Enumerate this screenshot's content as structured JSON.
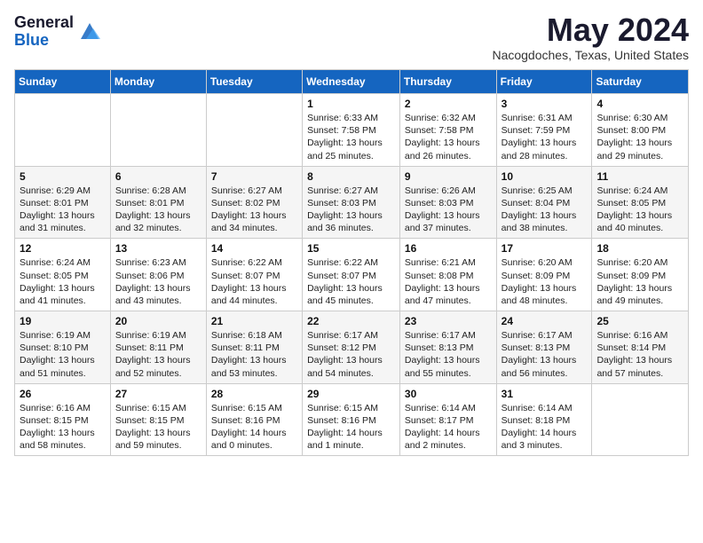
{
  "header": {
    "logo_general": "General",
    "logo_blue": "Blue",
    "month_year": "May 2024",
    "location": "Nacogdoches, Texas, United States"
  },
  "days_of_week": [
    "Sunday",
    "Monday",
    "Tuesday",
    "Wednesday",
    "Thursday",
    "Friday",
    "Saturday"
  ],
  "weeks": [
    [
      {
        "day": "",
        "sunrise": "",
        "sunset": "",
        "daylight": "",
        "empty": true
      },
      {
        "day": "",
        "sunrise": "",
        "sunset": "",
        "daylight": "",
        "empty": true
      },
      {
        "day": "",
        "sunrise": "",
        "sunset": "",
        "daylight": "",
        "empty": true
      },
      {
        "day": "1",
        "sunrise": "Sunrise: 6:33 AM",
        "sunset": "Sunset: 7:58 PM",
        "daylight": "Daylight: 13 hours and 25 minutes."
      },
      {
        "day": "2",
        "sunrise": "Sunrise: 6:32 AM",
        "sunset": "Sunset: 7:58 PM",
        "daylight": "Daylight: 13 hours and 26 minutes."
      },
      {
        "day": "3",
        "sunrise": "Sunrise: 6:31 AM",
        "sunset": "Sunset: 7:59 PM",
        "daylight": "Daylight: 13 hours and 28 minutes."
      },
      {
        "day": "4",
        "sunrise": "Sunrise: 6:30 AM",
        "sunset": "Sunset: 8:00 PM",
        "daylight": "Daylight: 13 hours and 29 minutes."
      }
    ],
    [
      {
        "day": "5",
        "sunrise": "Sunrise: 6:29 AM",
        "sunset": "Sunset: 8:01 PM",
        "daylight": "Daylight: 13 hours and 31 minutes."
      },
      {
        "day": "6",
        "sunrise": "Sunrise: 6:28 AM",
        "sunset": "Sunset: 8:01 PM",
        "daylight": "Daylight: 13 hours and 32 minutes."
      },
      {
        "day": "7",
        "sunrise": "Sunrise: 6:27 AM",
        "sunset": "Sunset: 8:02 PM",
        "daylight": "Daylight: 13 hours and 34 minutes."
      },
      {
        "day": "8",
        "sunrise": "Sunrise: 6:27 AM",
        "sunset": "Sunset: 8:03 PM",
        "daylight": "Daylight: 13 hours and 36 minutes."
      },
      {
        "day": "9",
        "sunrise": "Sunrise: 6:26 AM",
        "sunset": "Sunset: 8:03 PM",
        "daylight": "Daylight: 13 hours and 37 minutes."
      },
      {
        "day": "10",
        "sunrise": "Sunrise: 6:25 AM",
        "sunset": "Sunset: 8:04 PM",
        "daylight": "Daylight: 13 hours and 38 minutes."
      },
      {
        "day": "11",
        "sunrise": "Sunrise: 6:24 AM",
        "sunset": "Sunset: 8:05 PM",
        "daylight": "Daylight: 13 hours and 40 minutes."
      }
    ],
    [
      {
        "day": "12",
        "sunrise": "Sunrise: 6:24 AM",
        "sunset": "Sunset: 8:05 PM",
        "daylight": "Daylight: 13 hours and 41 minutes."
      },
      {
        "day": "13",
        "sunrise": "Sunrise: 6:23 AM",
        "sunset": "Sunset: 8:06 PM",
        "daylight": "Daylight: 13 hours and 43 minutes."
      },
      {
        "day": "14",
        "sunrise": "Sunrise: 6:22 AM",
        "sunset": "Sunset: 8:07 PM",
        "daylight": "Daylight: 13 hours and 44 minutes."
      },
      {
        "day": "15",
        "sunrise": "Sunrise: 6:22 AM",
        "sunset": "Sunset: 8:07 PM",
        "daylight": "Daylight: 13 hours and 45 minutes."
      },
      {
        "day": "16",
        "sunrise": "Sunrise: 6:21 AM",
        "sunset": "Sunset: 8:08 PM",
        "daylight": "Daylight: 13 hours and 47 minutes."
      },
      {
        "day": "17",
        "sunrise": "Sunrise: 6:20 AM",
        "sunset": "Sunset: 8:09 PM",
        "daylight": "Daylight: 13 hours and 48 minutes."
      },
      {
        "day": "18",
        "sunrise": "Sunrise: 6:20 AM",
        "sunset": "Sunset: 8:09 PM",
        "daylight": "Daylight: 13 hours and 49 minutes."
      }
    ],
    [
      {
        "day": "19",
        "sunrise": "Sunrise: 6:19 AM",
        "sunset": "Sunset: 8:10 PM",
        "daylight": "Daylight: 13 hours and 51 minutes."
      },
      {
        "day": "20",
        "sunrise": "Sunrise: 6:19 AM",
        "sunset": "Sunset: 8:11 PM",
        "daylight": "Daylight: 13 hours and 52 minutes."
      },
      {
        "day": "21",
        "sunrise": "Sunrise: 6:18 AM",
        "sunset": "Sunset: 8:11 PM",
        "daylight": "Daylight: 13 hours and 53 minutes."
      },
      {
        "day": "22",
        "sunrise": "Sunrise: 6:17 AM",
        "sunset": "Sunset: 8:12 PM",
        "daylight": "Daylight: 13 hours and 54 minutes."
      },
      {
        "day": "23",
        "sunrise": "Sunrise: 6:17 AM",
        "sunset": "Sunset: 8:13 PM",
        "daylight": "Daylight: 13 hours and 55 minutes."
      },
      {
        "day": "24",
        "sunrise": "Sunrise: 6:17 AM",
        "sunset": "Sunset: 8:13 PM",
        "daylight": "Daylight: 13 hours and 56 minutes."
      },
      {
        "day": "25",
        "sunrise": "Sunrise: 6:16 AM",
        "sunset": "Sunset: 8:14 PM",
        "daylight": "Daylight: 13 hours and 57 minutes."
      }
    ],
    [
      {
        "day": "26",
        "sunrise": "Sunrise: 6:16 AM",
        "sunset": "Sunset: 8:15 PM",
        "daylight": "Daylight: 13 hours and 58 minutes."
      },
      {
        "day": "27",
        "sunrise": "Sunrise: 6:15 AM",
        "sunset": "Sunset: 8:15 PM",
        "daylight": "Daylight: 13 hours and 59 minutes."
      },
      {
        "day": "28",
        "sunrise": "Sunrise: 6:15 AM",
        "sunset": "Sunset: 8:16 PM",
        "daylight": "Daylight: 14 hours and 0 minutes."
      },
      {
        "day": "29",
        "sunrise": "Sunrise: 6:15 AM",
        "sunset": "Sunset: 8:16 PM",
        "daylight": "Daylight: 14 hours and 1 minute."
      },
      {
        "day": "30",
        "sunrise": "Sunrise: 6:14 AM",
        "sunset": "Sunset: 8:17 PM",
        "daylight": "Daylight: 14 hours and 2 minutes."
      },
      {
        "day": "31",
        "sunrise": "Sunrise: 6:14 AM",
        "sunset": "Sunset: 8:18 PM",
        "daylight": "Daylight: 14 hours and 3 minutes."
      },
      {
        "day": "",
        "sunrise": "",
        "sunset": "",
        "daylight": "",
        "empty": true
      }
    ]
  ]
}
